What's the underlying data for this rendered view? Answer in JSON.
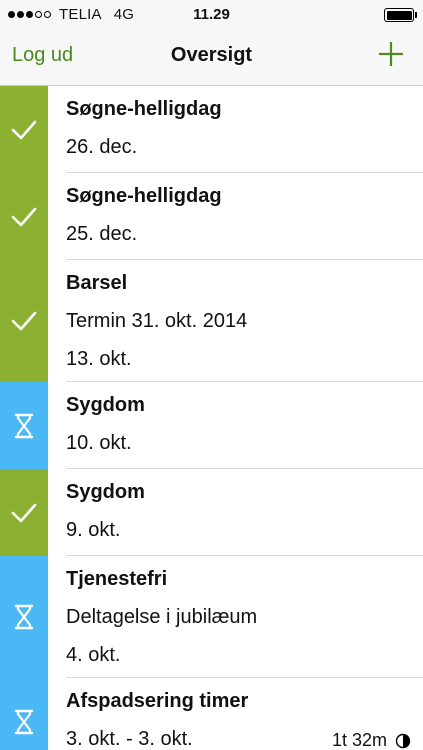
{
  "status_bar": {
    "carrier": "TELIA",
    "network": "4G",
    "time": "11.29",
    "battery_level": 1.0,
    "signal_bars": 3
  },
  "nav": {
    "left_label": "Log ud",
    "title": "Oversigt",
    "add_icon": "plus-icon",
    "accent_color": "#4a8b1e"
  },
  "colors": {
    "approved": "#8cb031",
    "pending": "#49b8f4"
  },
  "items": [
    {
      "status": "approved",
      "icon": "checkmark-icon",
      "title": "Søgne-helligdag",
      "lines": [
        "26. dec."
      ]
    },
    {
      "status": "approved",
      "icon": "checkmark-icon",
      "title": "Søgne-helligdag",
      "lines": [
        "25. dec."
      ]
    },
    {
      "status": "approved",
      "icon": "checkmark-icon",
      "title": "Barsel",
      "lines": [
        "Termin 31. okt. 2014",
        "13. okt."
      ]
    },
    {
      "status": "pending",
      "icon": "hourglass-icon",
      "title": "Sygdom",
      "lines": [
        "10. okt."
      ]
    },
    {
      "status": "approved",
      "icon": "checkmark-icon",
      "title": "Sygdom",
      "lines": [
        "9. okt."
      ]
    },
    {
      "status": "pending",
      "icon": "hourglass-icon",
      "title": "Tjenestefri",
      "lines": [
        "Deltagelse i jubilæum",
        "4. okt."
      ]
    },
    {
      "status": "pending",
      "icon": "hourglass-icon",
      "title": "Afspadsering timer",
      "lines": [
        "3. okt. - 3. okt."
      ],
      "duration": "1t 32m",
      "duration_icon": "half-circle-icon"
    }
  ]
}
